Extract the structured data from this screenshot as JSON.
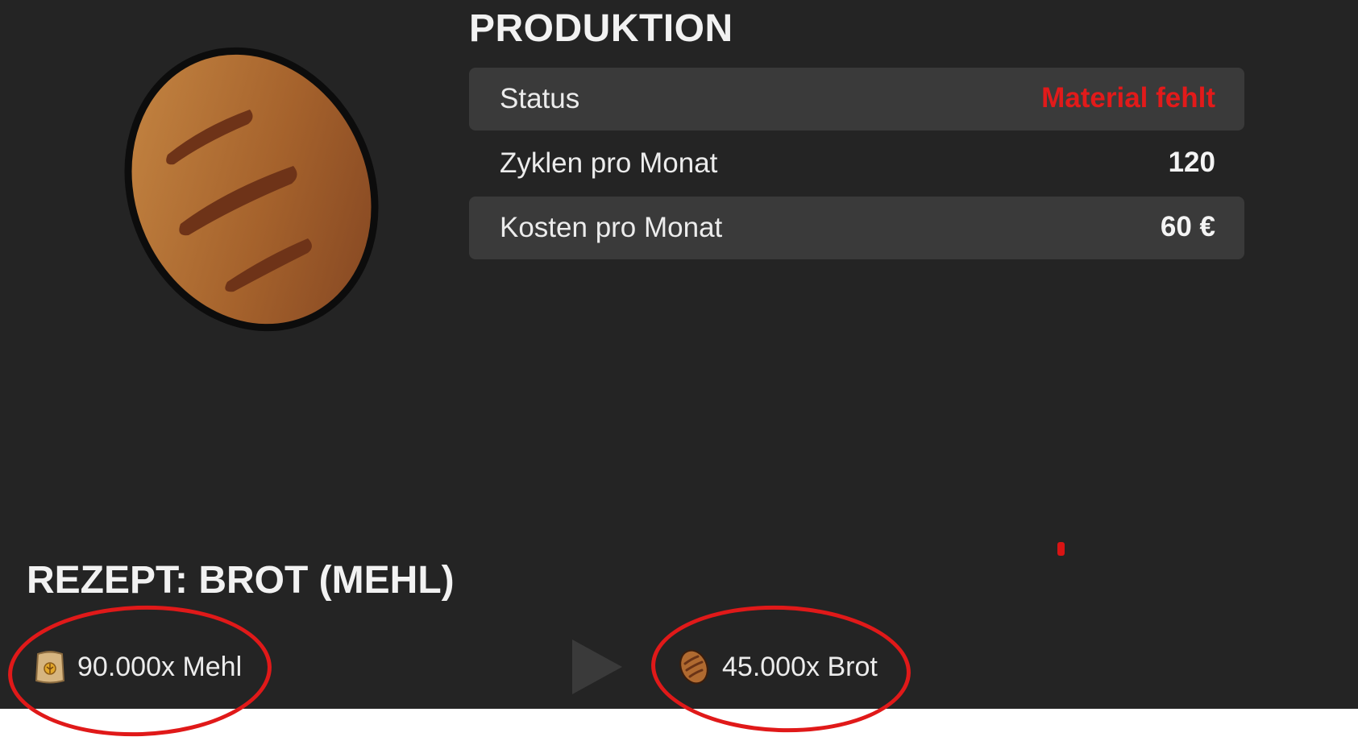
{
  "production": {
    "title": "PRODUKTION",
    "product_icon": "bread-loaf-icon",
    "stats": [
      {
        "label": "Status",
        "value": "Material fehlt",
        "value_color": "#e21a1a"
      },
      {
        "label": "Zyklen pro Monat",
        "value": "120"
      },
      {
        "label": "Kosten pro Monat",
        "value": "60 €"
      }
    ]
  },
  "recipe": {
    "title": "REZEPT: BROT (MEHL)",
    "input": {
      "icon": "flour-sack-icon",
      "text": "90.000x Mehl"
    },
    "arrow_icon": "play-arrow-icon",
    "output": {
      "icon": "bread-icon",
      "text": "45.000x Brot"
    }
  },
  "colors": {
    "panel_background": "#242424",
    "row_background": "#3a3a3a",
    "annotation": "#e01919"
  }
}
